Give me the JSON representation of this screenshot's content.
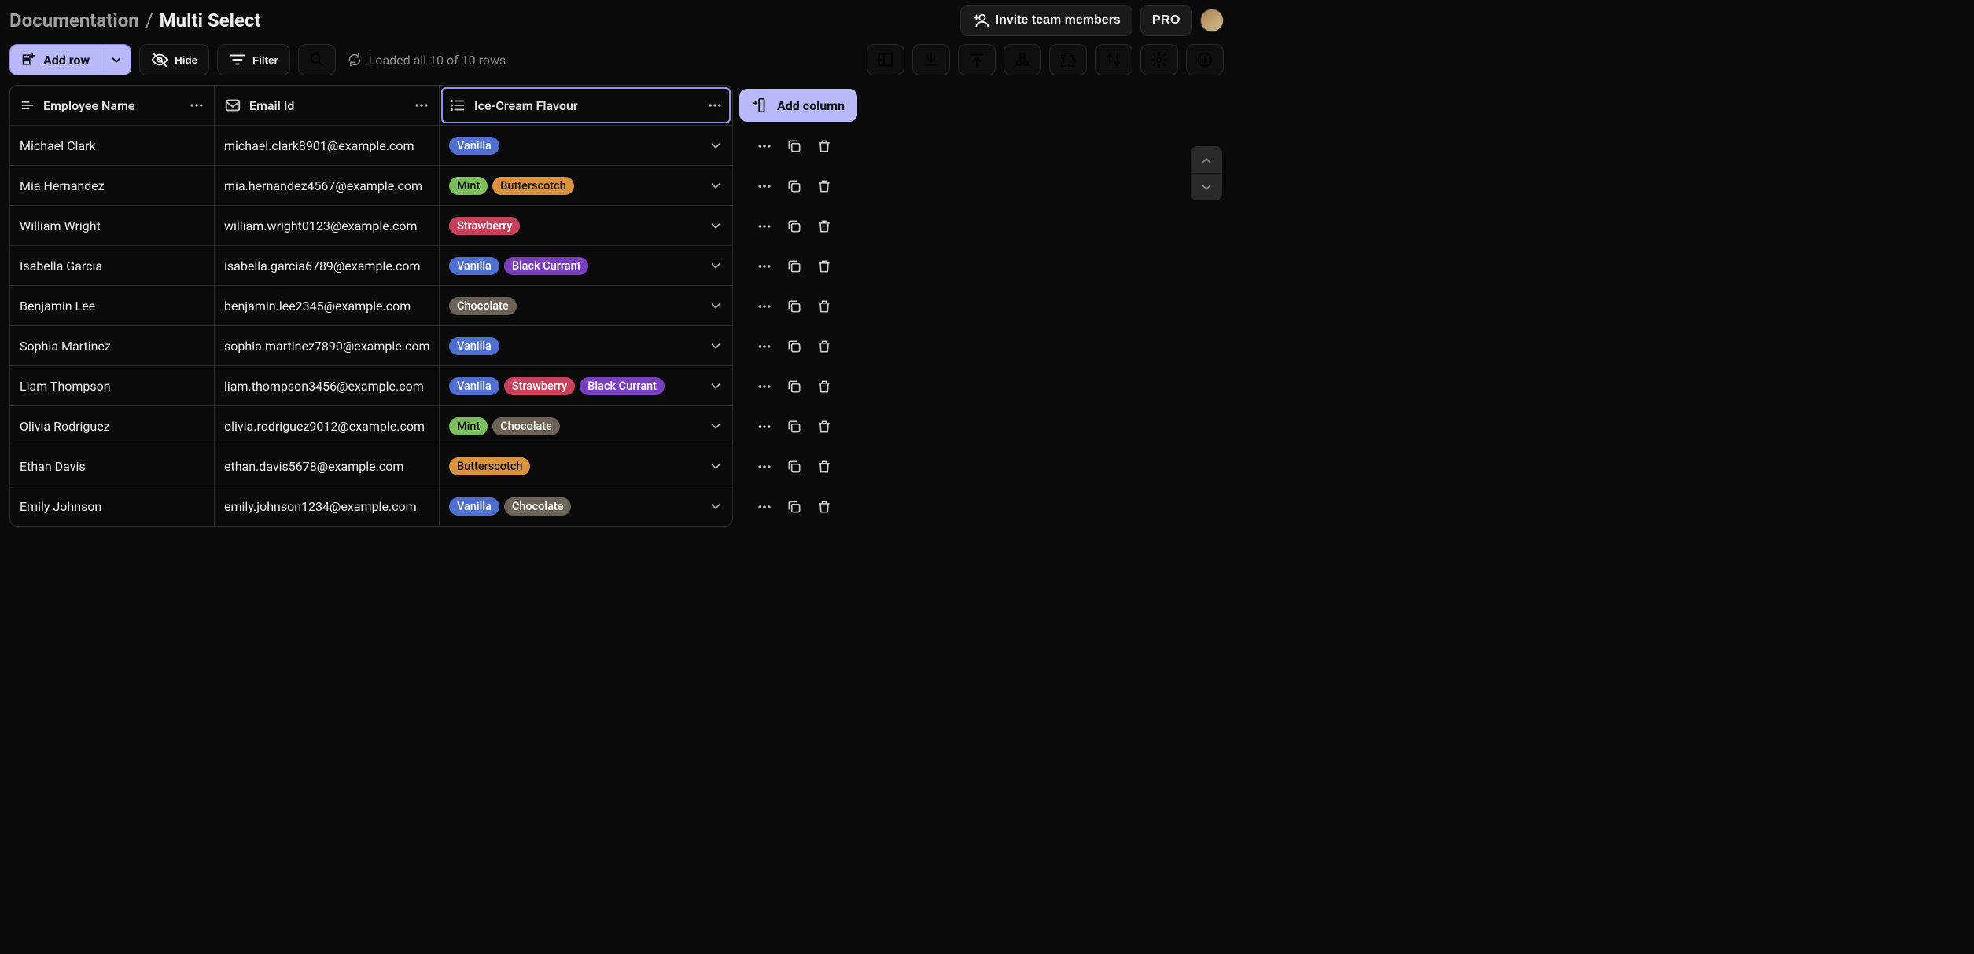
{
  "breadcrumb": {
    "parent": "Documentation",
    "sep": "/",
    "current": "Multi Select"
  },
  "header_actions": {
    "invite_label": "Invite team members",
    "pro_label": "PRO"
  },
  "toolbar": {
    "add_row_label": "Add row",
    "hide_label": "Hide",
    "filter_label": "Filter",
    "loaded_label": "Loaded all 10 of 10 rows"
  },
  "columns": {
    "name": {
      "label": "Employee Name"
    },
    "email": {
      "label": "Email Id"
    },
    "flavour": {
      "label": "Ice-Cream Flavour"
    }
  },
  "add_column_label": "Add column",
  "tag_colors": {
    "Vanilla": "#4f6fd1",
    "Mint": "#7bbf5a",
    "Butterscotch": "#d9923d",
    "Strawberry": "#c9405b",
    "Black Currant": "#7a3fbf",
    "Chocolate": "#6d6256"
  },
  "rows": [
    {
      "name": "Michael Clark",
      "email": "michael.clark8901@example.com",
      "flavours": [
        "Vanilla"
      ]
    },
    {
      "name": "Mia Hernandez",
      "email": "mia.hernandez4567@example.com",
      "flavours": [
        "Mint",
        "Butterscotch"
      ]
    },
    {
      "name": "William Wright",
      "email": "william.wright0123@example.com",
      "flavours": [
        "Strawberry"
      ]
    },
    {
      "name": "Isabella Garcia",
      "email": "isabella.garcia6789@example.com",
      "flavours": [
        "Vanilla",
        "Black Currant"
      ]
    },
    {
      "name": "Benjamin Lee",
      "email": "benjamin.lee2345@example.com",
      "flavours": [
        "Chocolate"
      ]
    },
    {
      "name": "Sophia Martinez",
      "email": "sophia.martinez7890@example.com",
      "flavours": [
        "Vanilla"
      ]
    },
    {
      "name": "Liam Thompson",
      "email": "liam.thompson3456@example.com",
      "flavours": [
        "Vanilla",
        "Strawberry",
        "Black Currant"
      ]
    },
    {
      "name": "Olivia Rodriguez",
      "email": "olivia.rodriguez9012@example.com",
      "flavours": [
        "Mint",
        "Chocolate"
      ]
    },
    {
      "name": "Ethan Davis",
      "email": "ethan.davis5678@example.com",
      "flavours": [
        "Butterscotch"
      ]
    },
    {
      "name": "Emily Johnson",
      "email": "emily.johnson1234@example.com",
      "flavours": [
        "Vanilla",
        "Chocolate"
      ]
    }
  ]
}
